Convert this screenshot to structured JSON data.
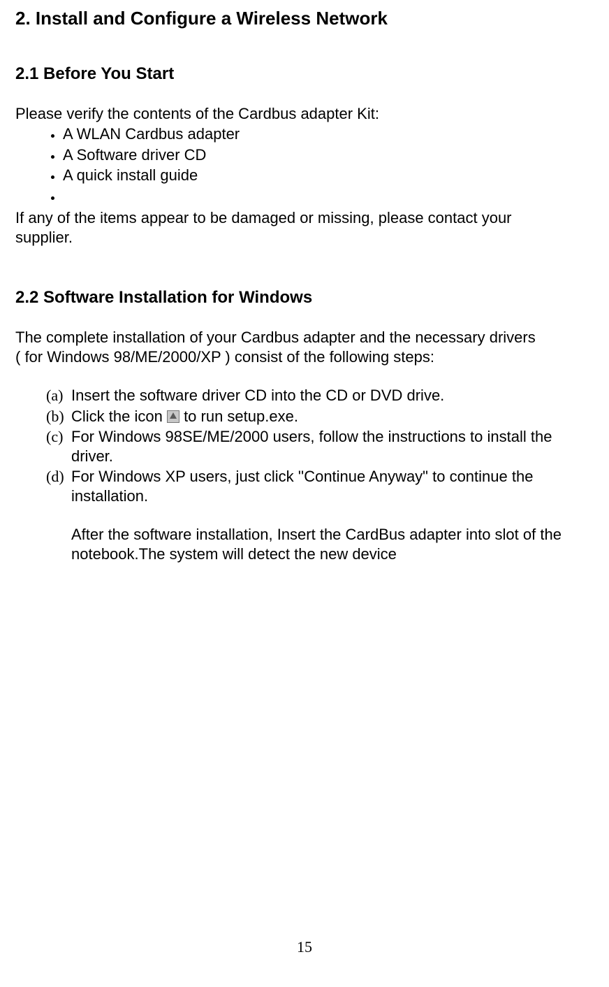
{
  "title": "2. Install and Configure a Wireless Network",
  "section_2_1": {
    "heading": "2.1 Before You Start",
    "intro": "Please verify the contents of the Cardbus adapter  Kit:",
    "kit_items": [
      "A WLAN Cardbus adapter",
      "A Software driver CD",
      "A quick install guide"
    ],
    "contact_line1": "If any of the items appear to be damaged or missing, please contact your",
    "contact_line2": "supplier."
  },
  "section_2_2": {
    "heading": "2.2 Software Installation for Windows",
    "intro_line1": "The complete installation of your Cardbus adapter  and the necessary drivers",
    "intro_line2": "( for Windows 98/ME/2000/XP ) consist of the following steps:",
    "steps": [
      {
        "label": "(a)",
        "text": "Insert the software driver CD into the CD or DVD drive."
      },
      {
        "label": "(b)",
        "pre": "Click the icon ",
        "post": " to run setup.exe."
      },
      {
        "label": "(c)",
        "text": "For Windows 98SE/ME/2000 users, follow the instructions to install the driver."
      },
      {
        "label": "(d)",
        "text": "For Windows XP users, just click ''Continue Anyway\" to continue the installation."
      }
    ],
    "after": "After the software installation, Insert the CardBus adapter into slot of the notebook.The system will detect the new device"
  },
  "page_number": "15"
}
